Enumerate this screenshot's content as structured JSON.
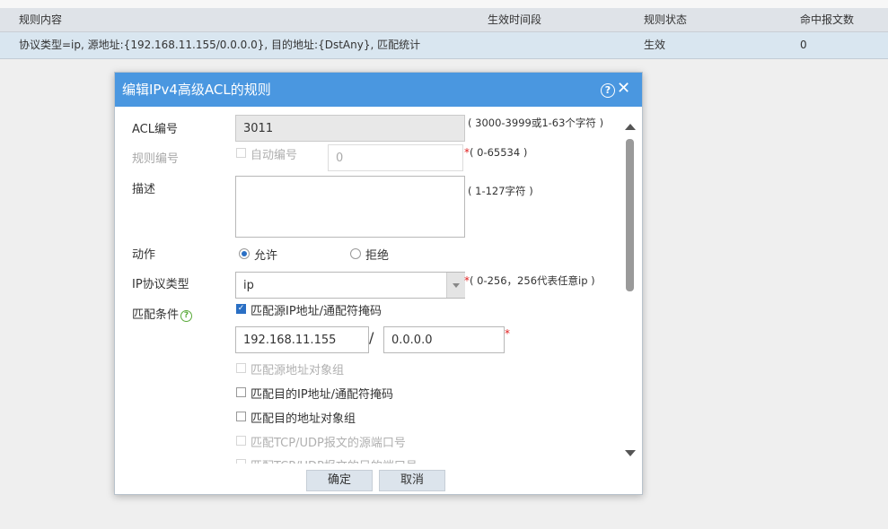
{
  "table": {
    "headers": [
      "规则内容",
      "生效时间段",
      "规则状态",
      "命中报文数"
    ],
    "rows": [
      {
        "content": "协议类型=ip, 源地址:{192.168.11.155/0.0.0.0}, 目的地址:{DstAny}, 匹配统计",
        "time": "",
        "status": "生效",
        "hits": "0"
      }
    ]
  },
  "dialog": {
    "title": "编辑IPv4高级ACL的规则",
    "help_icon": "question-circle-icon",
    "close_icon": "close-x-icon",
    "acl_number": {
      "label": "ACL编号",
      "value": "3011",
      "hint": "( 3000-3999或1-63个字符 )"
    },
    "rule_number": {
      "label": "规则编号",
      "auto_label": "自动编号",
      "value": "0",
      "hint": "( 0-65534 )"
    },
    "description": {
      "label": "描述",
      "value": "",
      "hint": "( 1-127字符 )"
    },
    "action": {
      "label": "动作",
      "permit": "允许",
      "deny": "拒绝",
      "selected": "permit"
    },
    "ip_protocol": {
      "label": "IP协议类型",
      "value": "ip",
      "hint": "( 0-256，256代表任意ip )"
    },
    "match": {
      "label": "匹配条件",
      "src_ip_label": "匹配源IP地址/通配符掩码",
      "src_ip": "192.168.11.155",
      "src_wildcard": "0.0.0.0",
      "separator": "/",
      "src_obj_group": "匹配源地址对象组",
      "dst_ip_label": "匹配目的IP地址/通配符掩码",
      "dst_obj_group": "匹配目的地址对象组",
      "src_port": "匹配TCP/UDP报文的源端口号",
      "dst_port": "匹配TCP/UDP报文的目的端口号"
    },
    "required_mark": "*",
    "ok_label": "确定",
    "cancel_label": "取消"
  },
  "colors": {
    "header_bar": "#4a97e0",
    "selected_row": "#d9e6f0",
    "accent": "#2a6fc4",
    "required": "#e02020"
  }
}
